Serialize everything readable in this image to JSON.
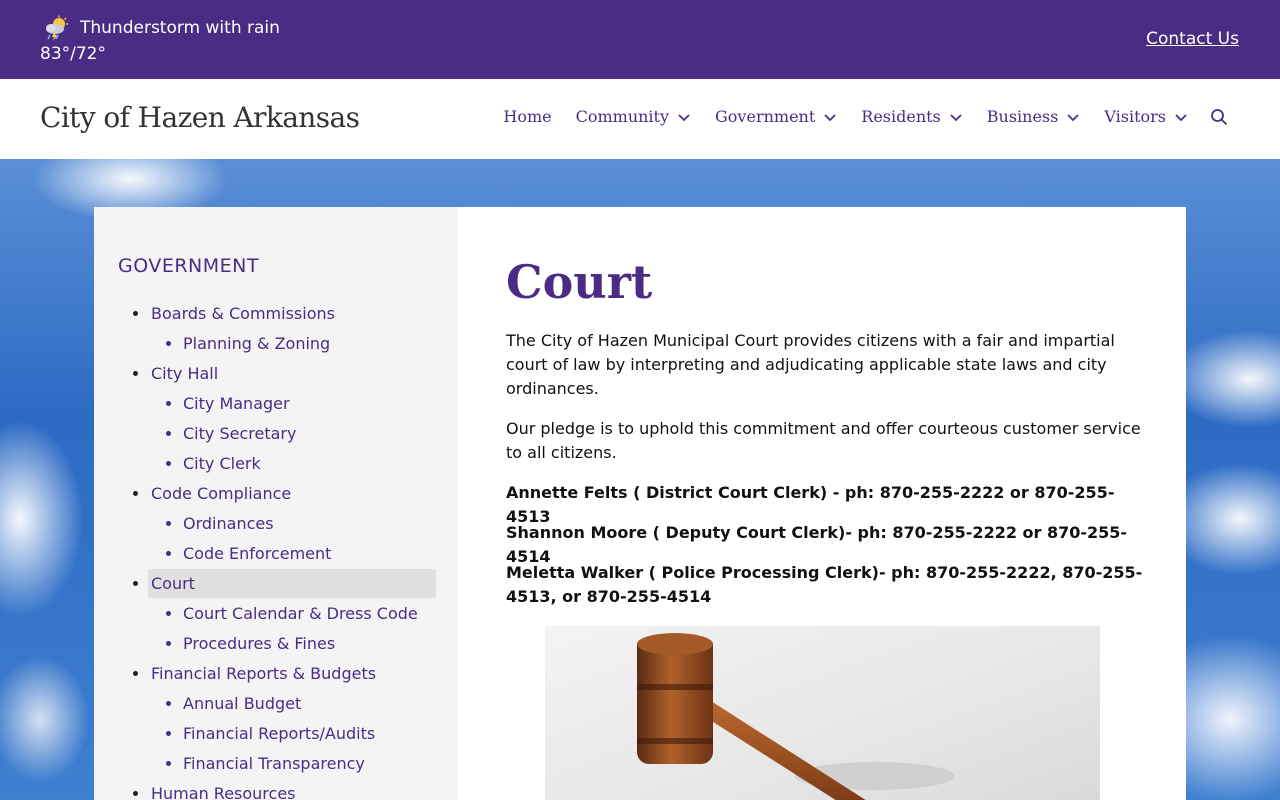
{
  "topbar": {
    "weather_icon": "thunderstorm-rain-icon",
    "condition": "Thunderstorm with rain",
    "temperature": "83°/72°",
    "contact_label": "Contact Us",
    "bg_color": "#4b2c85"
  },
  "header": {
    "site_title": "City of Hazen Arkansas",
    "nav": [
      {
        "label": "Home",
        "has_dropdown": false
      },
      {
        "label": "Community",
        "has_dropdown": true
      },
      {
        "label": "Government",
        "has_dropdown": true
      },
      {
        "label": "Residents",
        "has_dropdown": true
      },
      {
        "label": "Business",
        "has_dropdown": true
      },
      {
        "label": "Visitors",
        "has_dropdown": true
      }
    ],
    "search_icon": "search-icon"
  },
  "sidebar": {
    "heading": "GOVERNMENT",
    "items": [
      {
        "label": "Boards & Commissions",
        "level": 1
      },
      {
        "label": "Planning & Zoning",
        "level": 2
      },
      {
        "label": "City Hall",
        "level": 1
      },
      {
        "label": "City Manager",
        "level": 2
      },
      {
        "label": "City Secretary",
        "level": 2
      },
      {
        "label": "City Clerk",
        "level": 2
      },
      {
        "label": "Code Compliance",
        "level": 1
      },
      {
        "label": "Ordinances",
        "level": 2
      },
      {
        "label": "Code Enforcement",
        "level": 2
      },
      {
        "label": "Court",
        "level": 1,
        "active": true
      },
      {
        "label": "Court Calendar & Dress Code",
        "level": 2
      },
      {
        "label": "Procedures & Fines",
        "level": 2
      },
      {
        "label": "Financial Reports & Budgets",
        "level": 1
      },
      {
        "label": "Annual Budget",
        "level": 2
      },
      {
        "label": "Financial Reports/Audits",
        "level": 2
      },
      {
        "label": "Financial Transparency",
        "level": 2
      },
      {
        "label": "Human Resources",
        "level": 1
      }
    ]
  },
  "main": {
    "title": "Court",
    "paragraphs": [
      "The City of Hazen Municipal Court provides citizens with a fair and impartial court of law by interpreting and adjudicating applicable state laws and city ordinances.",
      "Our pledge is to uphold this commitment and offer courteous customer service to all citizens."
    ],
    "contacts": [
      "Annette Felts ( District Court Clerk) - ph: 870-255-2222 or 870-255-4513",
      "Shannon Moore ( Deputy Court Clerk)- ph: 870-255-2222 or 870-255-4514",
      "Meletta Walker ( Police Processing Clerk)- ph: 870-255-2222, 870-255-4513, or 870-255-4514"
    ],
    "image": "gavel-image"
  }
}
